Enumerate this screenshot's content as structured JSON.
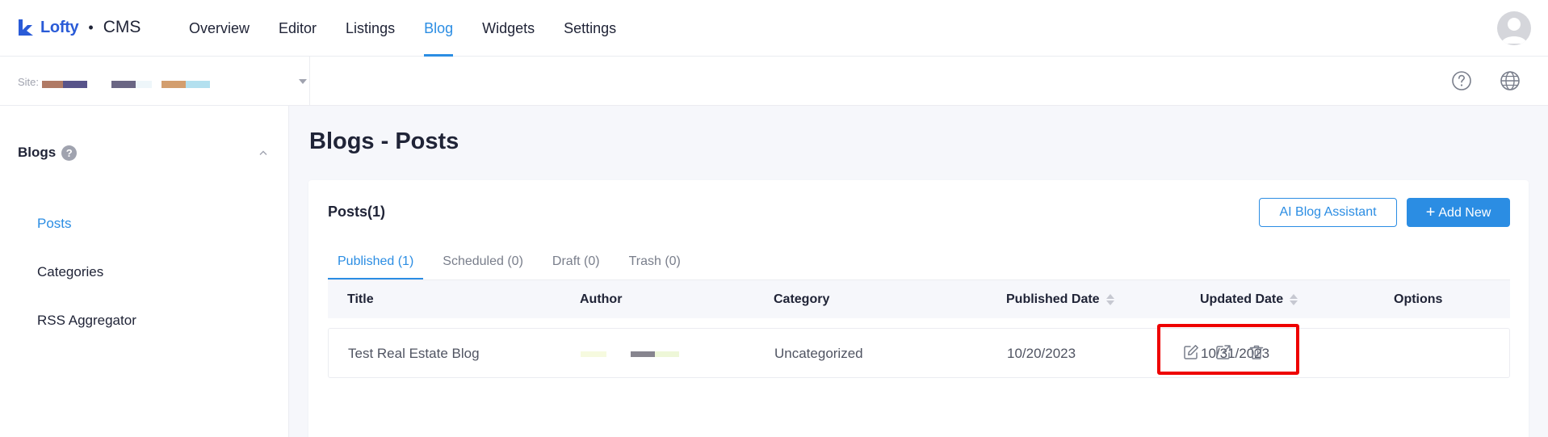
{
  "header": {
    "brand": "Lofty",
    "separator": "•",
    "product": "CMS",
    "nav": [
      {
        "label": "Overview",
        "active": false
      },
      {
        "label": "Editor",
        "active": false
      },
      {
        "label": "Listings",
        "active": false
      },
      {
        "label": "Blog",
        "active": true
      },
      {
        "label": "Widgets",
        "active": false
      },
      {
        "label": "Settings",
        "active": false
      }
    ],
    "avatar_icon": "user-avatar-icon"
  },
  "sitebar": {
    "label": "Site:",
    "swatch_colors": [
      "#b07a65",
      "#58548a",
      "#6a6684",
      "#eef6fa",
      "#d39e6e",
      "#b3e0ef"
    ],
    "help_icon": "question-circle-icon",
    "language_icon": "globe-icon"
  },
  "sidebar": {
    "title": "Blogs",
    "help": "?",
    "items": [
      {
        "label": "Posts",
        "active": true
      },
      {
        "label": "Categories",
        "active": false
      },
      {
        "label": "RSS Aggregator",
        "active": false
      }
    ]
  },
  "main": {
    "page_title": "Blogs - Posts",
    "card_title": "Posts(1)",
    "ai_button": "AI Blog Assistant",
    "add_button": "Add New",
    "add_button_icon": "+",
    "tabs": [
      {
        "label": "Published (1)",
        "active": true
      },
      {
        "label": "Scheduled (0)",
        "active": false
      },
      {
        "label": "Draft (0)",
        "active": false
      },
      {
        "label": "Trash (0)",
        "active": false
      }
    ],
    "columns": [
      "Title",
      "Author",
      "Category",
      "Published Date",
      "Updated Date",
      "Options"
    ],
    "rows": [
      {
        "title": "Test Real Estate Blog",
        "author_swatch_colors": [
          "#f6fadf",
          "#87858f",
          "#eef7d8"
        ],
        "category": "Uncategorized",
        "published": "10/20/2023",
        "updated": "10/31/2023",
        "options": [
          "edit-icon",
          "share-icon",
          "trash-icon"
        ]
      }
    ]
  },
  "colors": {
    "accent": "#2b8de3",
    "brand": "#2a5bd7",
    "highlight": "#ee0000"
  }
}
